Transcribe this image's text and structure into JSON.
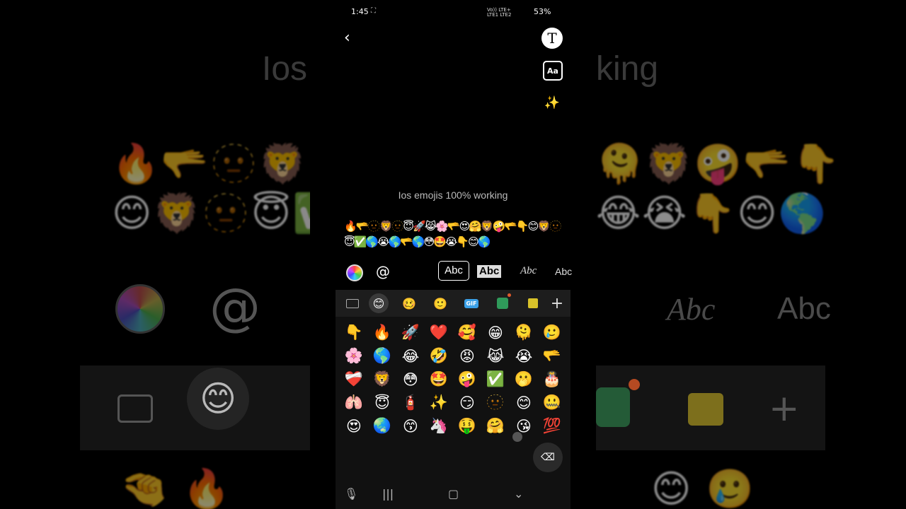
{
  "status": {
    "time": "1:45",
    "extra": "◁▷",
    "signal": "Vo)) LTE+\nLTE1 LTE2",
    "battery": "53%"
  },
  "icons": {
    "back": "chevron-left-icon",
    "text": "text-T-icon",
    "font_size": "Aa",
    "sparkle": "sparkle-icon"
  },
  "tool_font_label": "Aa",
  "caption": "Ios emojis 100% working",
  "emoji_text": "🔥🫳🫥🦁🫥😇🚀😹🌸🫳😍🤗🦁🤪🫳👇😊🦁🫥😇✅🌎😭🌎🫳🌎😳🤩😭👇😊🌎",
  "font_styles": [
    "Abc",
    "Abc",
    "Abc",
    "Abc"
  ],
  "kb_tabs": [
    "keyboard-icon",
    "smiley-icon",
    "sticker-icon",
    "kaomoji-icon",
    "GIF",
    "bitmoji-icon",
    "custom-sticker-icon",
    "+"
  ],
  "emoji_grid": [
    "👇",
    "🔥",
    "🚀",
    "❤️",
    "🥰",
    "😁",
    "🫠",
    "🥲",
    "🌸",
    "🌎",
    "😂",
    "🤣",
    "😡",
    "😹",
    "😭",
    "🫳",
    "❤️‍🩹",
    "🦁",
    "😳",
    "🤩",
    "🤪",
    "✅",
    "🫢",
    "🎂",
    "🫁",
    "😇",
    "🧯",
    "✨",
    "😏",
    "🫥",
    "😊",
    "🤐",
    "😍",
    "🌏",
    "😙",
    "🦄",
    "🤑",
    "🤗",
    "😘",
    "💯"
  ],
  "bg": {
    "title_left": "Ios",
    "title_right": "king",
    "row1_left": "🔥🫳🫥🦁🫥",
    "row2_left": "😊🦁🫥😇✅",
    "row1_right": "🫠🦁🤪🫳👇",
    "row2_right": "😂😭👇😊🌎",
    "abc_script": "Abc",
    "abc_plain": "Abc",
    "bottom_left": "🤏 🔥",
    "bottom_right": "😊 🥲"
  }
}
